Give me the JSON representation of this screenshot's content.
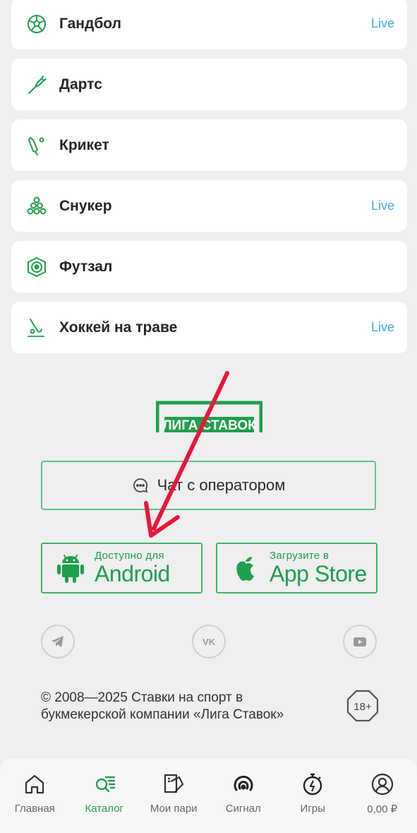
{
  "sports": [
    {
      "label": "Гандбол",
      "live": "Live",
      "icon": "handball-ball-icon"
    },
    {
      "label": "Дартс",
      "live": "",
      "icon": "dart-icon"
    },
    {
      "label": "Крикет",
      "live": "",
      "icon": "cricket-bat-icon"
    },
    {
      "label": "Снукер",
      "live": "Live",
      "icon": "snooker-balls-icon"
    },
    {
      "label": "Футзал",
      "live": "",
      "icon": "futsal-ball-icon"
    },
    {
      "label": "Хоккей на траве",
      "live": "Live",
      "icon": "field-hockey-icon"
    }
  ],
  "logo": {
    "text": "ЛИГА СТАВОК"
  },
  "chat": {
    "label": "Чат с оператором"
  },
  "stores": {
    "android": {
      "small": "Доступно для",
      "big": "Android"
    },
    "apple": {
      "small": "Загрузите в",
      "big": "App Store"
    }
  },
  "footer": {
    "copyright_line1": "© 2008—2025 Ставки на спорт в",
    "copyright_line2": "букмекерской компании «Лига Ставок»",
    "age": "18+"
  },
  "nav": [
    {
      "label": "Главная",
      "icon": "home-icon"
    },
    {
      "label": "Каталог",
      "icon": "catalog-search-icon",
      "active": true
    },
    {
      "label": "Мои пари",
      "icon": "tickets-icon"
    },
    {
      "label": "Сигнал",
      "icon": "signal-icon"
    },
    {
      "label": "Игры",
      "icon": "stopwatch-icon"
    },
    {
      "label": "0,00 ₽",
      "icon": "profile-icon"
    }
  ],
  "colors": {
    "accent": "#1ea04c",
    "live": "#3aa8e8",
    "annotation_arrow": "#e8173a"
  }
}
